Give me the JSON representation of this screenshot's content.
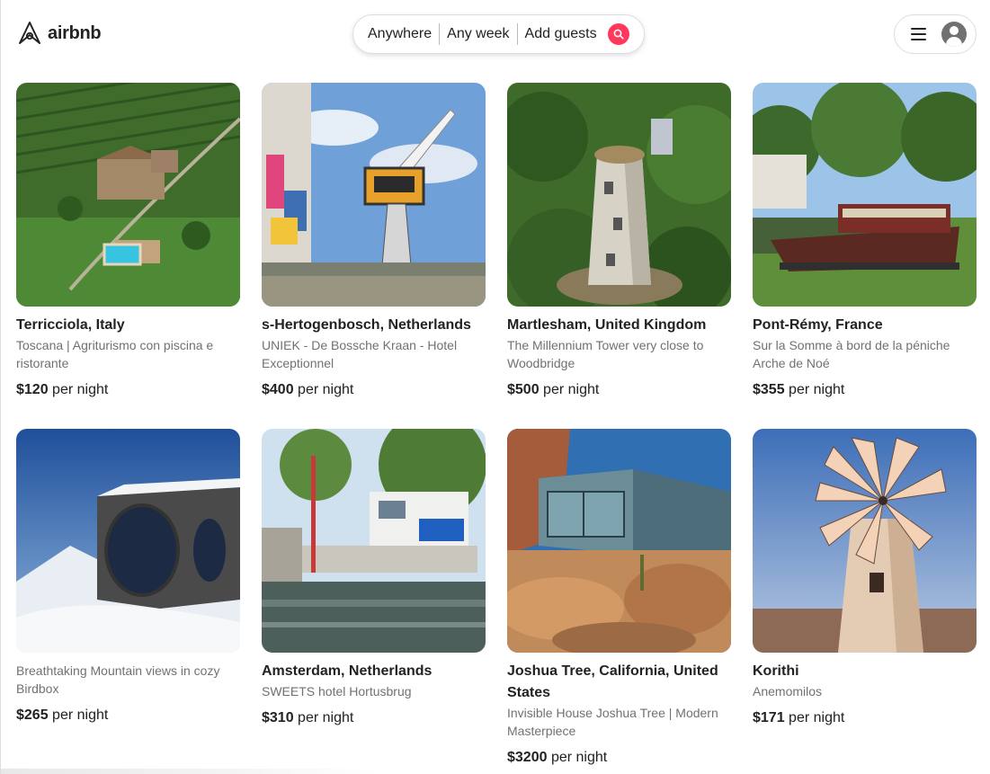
{
  "header": {
    "brand": "airbnb",
    "search": {
      "location": "Anywhere",
      "dates": "Any week",
      "guests": "Add guests"
    },
    "icons": [
      "airbnb-logo-icon",
      "search-icon",
      "hamburger-menu-icon",
      "user-avatar-icon"
    ],
    "accent_color": "#ff385c"
  },
  "listings": [
    {
      "title": "Terricciola, Italy",
      "desc": "Toscana | Agriturismo con piscina e ristorante",
      "price": "$120",
      "unit": "per night"
    },
    {
      "title": "s-Hertogenbosch, Netherlands",
      "desc": "UNIEK - De Bossche Kraan - Hotel Exceptionnel",
      "price": "$400",
      "unit": "per night"
    },
    {
      "title": "Martlesham, United Kingdom",
      "desc": "The Millennium Tower very close to Woodbridge",
      "price": "$500",
      "unit": "per night"
    },
    {
      "title": "Pont-Rémy, France",
      "desc": "Sur la Somme à bord de la péniche Arche de Noé",
      "price": "$355",
      "unit": "per night"
    },
    {
      "title": "",
      "desc": "Breathtaking Mountain views in cozy Birdbox",
      "price": "$265",
      "unit": "per night"
    },
    {
      "title": "Amsterdam, Netherlands",
      "desc": "SWEETS hotel Hortusbrug",
      "price": "$310",
      "unit": "per night"
    },
    {
      "title": "Joshua Tree, California, United States",
      "desc": "Invisible House Joshua Tree | Modern Masterpiece",
      "price": "$3200",
      "unit": "per night"
    },
    {
      "title": "Korithi",
      "desc": "Anemomilos",
      "price": "$171",
      "unit": "per night"
    }
  ]
}
